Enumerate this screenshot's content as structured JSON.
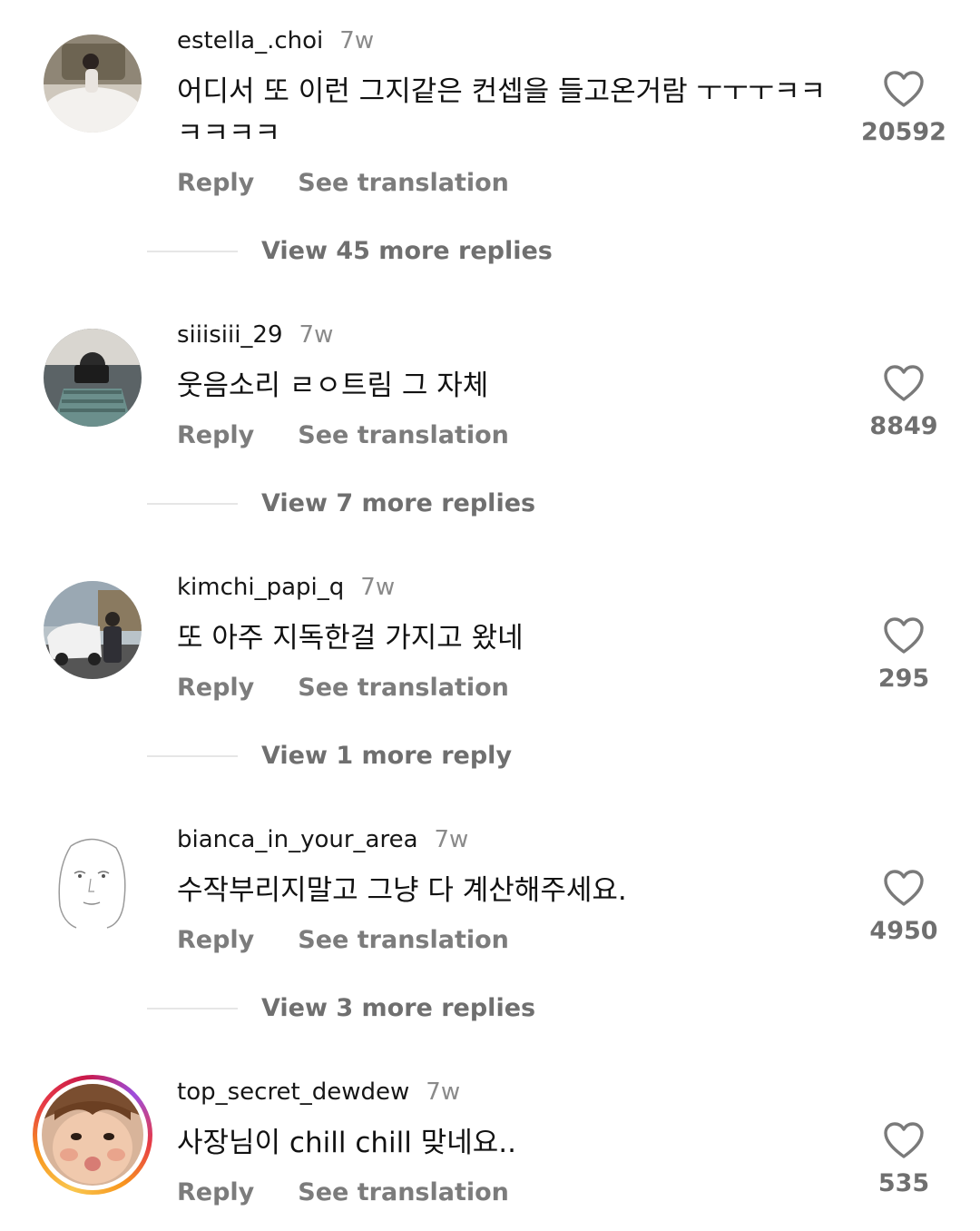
{
  "comments": [
    {
      "username": "estella_.choi",
      "time": "7w",
      "text": "어디서 또 이런 그지같은 컨셉을 들고온거람 ㅜㅜㅜㅋㅋ ㅋㅋㅋㅋ",
      "reply": "Reply",
      "translate": "See translation",
      "likes": "20592",
      "more": "View 45 more replies"
    },
    {
      "username": "siiisiii_29",
      "time": "7w",
      "text": "웃음소리 ㄹㅇ트림 그 자체",
      "reply": "Reply",
      "translate": "See translation",
      "likes": "8849",
      "more": "View 7 more replies"
    },
    {
      "username": "kimchi_papi_q",
      "time": "7w",
      "text": "또 아주 지독한걸 가지고 왔네",
      "reply": "Reply",
      "translate": "See translation",
      "likes": "295",
      "more": "View 1 more reply"
    },
    {
      "username": "bianca_in_your_area",
      "time": "7w",
      "text": "수작부리지말고 그냥 다 계산해주세요.",
      "reply": "Reply",
      "translate": "See translation",
      "likes": "4950",
      "more": "View 3 more replies"
    },
    {
      "username": "top_secret_dewdew",
      "time": "7w",
      "text": "사장님이 chill chill 맞네요..",
      "reply": "Reply",
      "translate": "See translation",
      "likes": "535"
    }
  ]
}
